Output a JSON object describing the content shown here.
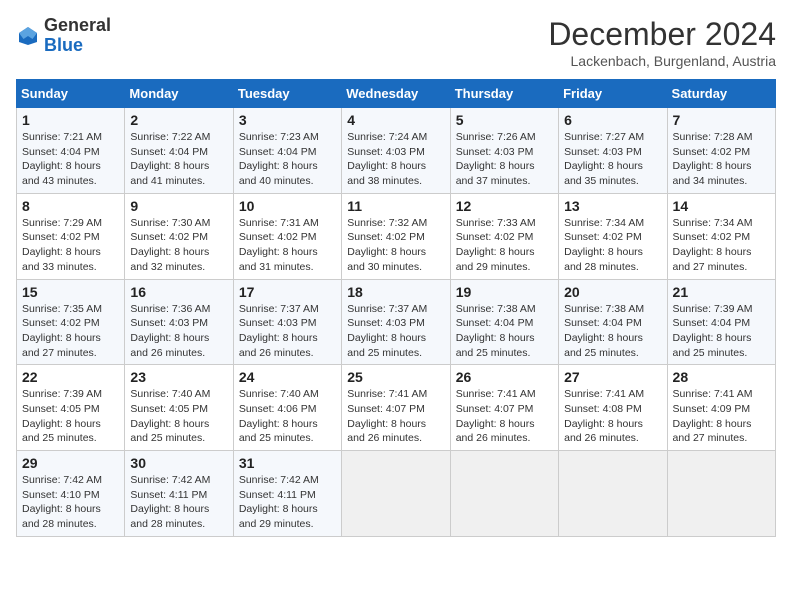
{
  "logo": {
    "text_general": "General",
    "text_blue": "Blue"
  },
  "title": "December 2024",
  "location": "Lackenbach, Burgenland, Austria",
  "days_of_week": [
    "Sunday",
    "Monday",
    "Tuesday",
    "Wednesday",
    "Thursday",
    "Friday",
    "Saturday"
  ],
  "weeks": [
    [
      {
        "day": 1,
        "lines": [
          "Sunrise: 7:21 AM",
          "Sunset: 4:04 PM",
          "Daylight: 8 hours",
          "and 43 minutes."
        ]
      },
      {
        "day": 2,
        "lines": [
          "Sunrise: 7:22 AM",
          "Sunset: 4:04 PM",
          "Daylight: 8 hours",
          "and 41 minutes."
        ]
      },
      {
        "day": 3,
        "lines": [
          "Sunrise: 7:23 AM",
          "Sunset: 4:04 PM",
          "Daylight: 8 hours",
          "and 40 minutes."
        ]
      },
      {
        "day": 4,
        "lines": [
          "Sunrise: 7:24 AM",
          "Sunset: 4:03 PM",
          "Daylight: 8 hours",
          "and 38 minutes."
        ]
      },
      {
        "day": 5,
        "lines": [
          "Sunrise: 7:26 AM",
          "Sunset: 4:03 PM",
          "Daylight: 8 hours",
          "and 37 minutes."
        ]
      },
      {
        "day": 6,
        "lines": [
          "Sunrise: 7:27 AM",
          "Sunset: 4:03 PM",
          "Daylight: 8 hours",
          "and 35 minutes."
        ]
      },
      {
        "day": 7,
        "lines": [
          "Sunrise: 7:28 AM",
          "Sunset: 4:02 PM",
          "Daylight: 8 hours",
          "and 34 minutes."
        ]
      }
    ],
    [
      {
        "day": 8,
        "lines": [
          "Sunrise: 7:29 AM",
          "Sunset: 4:02 PM",
          "Daylight: 8 hours",
          "and 33 minutes."
        ]
      },
      {
        "day": 9,
        "lines": [
          "Sunrise: 7:30 AM",
          "Sunset: 4:02 PM",
          "Daylight: 8 hours",
          "and 32 minutes."
        ]
      },
      {
        "day": 10,
        "lines": [
          "Sunrise: 7:31 AM",
          "Sunset: 4:02 PM",
          "Daylight: 8 hours",
          "and 31 minutes."
        ]
      },
      {
        "day": 11,
        "lines": [
          "Sunrise: 7:32 AM",
          "Sunset: 4:02 PM",
          "Daylight: 8 hours",
          "and 30 minutes."
        ]
      },
      {
        "day": 12,
        "lines": [
          "Sunrise: 7:33 AM",
          "Sunset: 4:02 PM",
          "Daylight: 8 hours",
          "and 29 minutes."
        ]
      },
      {
        "day": 13,
        "lines": [
          "Sunrise: 7:34 AM",
          "Sunset: 4:02 PM",
          "Daylight: 8 hours",
          "and 28 minutes."
        ]
      },
      {
        "day": 14,
        "lines": [
          "Sunrise: 7:34 AM",
          "Sunset: 4:02 PM",
          "Daylight: 8 hours",
          "and 27 minutes."
        ]
      }
    ],
    [
      {
        "day": 15,
        "lines": [
          "Sunrise: 7:35 AM",
          "Sunset: 4:02 PM",
          "Daylight: 8 hours",
          "and 27 minutes."
        ]
      },
      {
        "day": 16,
        "lines": [
          "Sunrise: 7:36 AM",
          "Sunset: 4:03 PM",
          "Daylight: 8 hours",
          "and 26 minutes."
        ]
      },
      {
        "day": 17,
        "lines": [
          "Sunrise: 7:37 AM",
          "Sunset: 4:03 PM",
          "Daylight: 8 hours",
          "and 26 minutes."
        ]
      },
      {
        "day": 18,
        "lines": [
          "Sunrise: 7:37 AM",
          "Sunset: 4:03 PM",
          "Daylight: 8 hours",
          "and 25 minutes."
        ]
      },
      {
        "day": 19,
        "lines": [
          "Sunrise: 7:38 AM",
          "Sunset: 4:04 PM",
          "Daylight: 8 hours",
          "and 25 minutes."
        ]
      },
      {
        "day": 20,
        "lines": [
          "Sunrise: 7:38 AM",
          "Sunset: 4:04 PM",
          "Daylight: 8 hours",
          "and 25 minutes."
        ]
      },
      {
        "day": 21,
        "lines": [
          "Sunrise: 7:39 AM",
          "Sunset: 4:04 PM",
          "Daylight: 8 hours",
          "and 25 minutes."
        ]
      }
    ],
    [
      {
        "day": 22,
        "lines": [
          "Sunrise: 7:39 AM",
          "Sunset: 4:05 PM",
          "Daylight: 8 hours",
          "and 25 minutes."
        ]
      },
      {
        "day": 23,
        "lines": [
          "Sunrise: 7:40 AM",
          "Sunset: 4:05 PM",
          "Daylight: 8 hours",
          "and 25 minutes."
        ]
      },
      {
        "day": 24,
        "lines": [
          "Sunrise: 7:40 AM",
          "Sunset: 4:06 PM",
          "Daylight: 8 hours",
          "and 25 minutes."
        ]
      },
      {
        "day": 25,
        "lines": [
          "Sunrise: 7:41 AM",
          "Sunset: 4:07 PM",
          "Daylight: 8 hours",
          "and 26 minutes."
        ]
      },
      {
        "day": 26,
        "lines": [
          "Sunrise: 7:41 AM",
          "Sunset: 4:07 PM",
          "Daylight: 8 hours",
          "and 26 minutes."
        ]
      },
      {
        "day": 27,
        "lines": [
          "Sunrise: 7:41 AM",
          "Sunset: 4:08 PM",
          "Daylight: 8 hours",
          "and 26 minutes."
        ]
      },
      {
        "day": 28,
        "lines": [
          "Sunrise: 7:41 AM",
          "Sunset: 4:09 PM",
          "Daylight: 8 hours",
          "and 27 minutes."
        ]
      }
    ],
    [
      {
        "day": 29,
        "lines": [
          "Sunrise: 7:42 AM",
          "Sunset: 4:10 PM",
          "Daylight: 8 hours",
          "and 28 minutes."
        ]
      },
      {
        "day": 30,
        "lines": [
          "Sunrise: 7:42 AM",
          "Sunset: 4:11 PM",
          "Daylight: 8 hours",
          "and 28 minutes."
        ]
      },
      {
        "day": 31,
        "lines": [
          "Sunrise: 7:42 AM",
          "Sunset: 4:11 PM",
          "Daylight: 8 hours",
          "and 29 minutes."
        ]
      },
      null,
      null,
      null,
      null
    ]
  ]
}
